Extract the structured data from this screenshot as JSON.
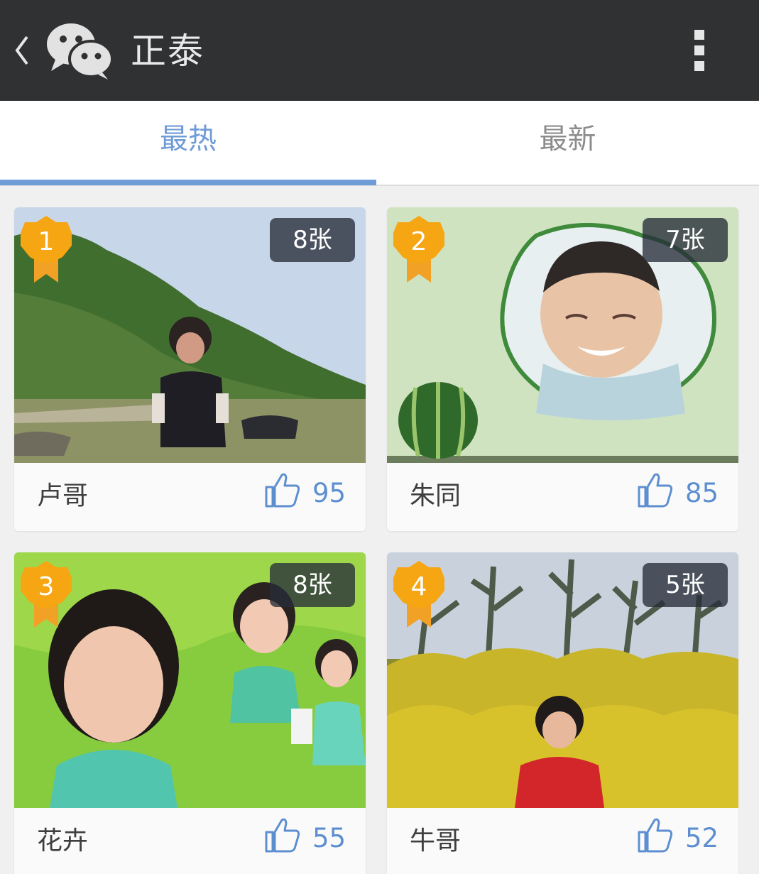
{
  "header": {
    "title": "正泰",
    "back_icon": "chevron-left-icon",
    "logo_icon": "wechat-icon",
    "menu_icon": "more-vertical-icon"
  },
  "tabs": [
    {
      "label": "最热",
      "active": true
    },
    {
      "label": "最新",
      "active": false
    }
  ],
  "colors": {
    "header_bg": "#2f3133",
    "accent": "#6f9bd6",
    "rank_badge": "#f5a012",
    "like_count": "#5d8fd0"
  },
  "cards": [
    {
      "rank": "1",
      "count": "8张",
      "name": "卢哥",
      "likes": "95"
    },
    {
      "rank": "2",
      "count": "7张",
      "name": "朱同",
      "likes": "85"
    },
    {
      "rank": "3",
      "count": "8张",
      "name": "花卉",
      "likes": "55"
    },
    {
      "rank": "4",
      "count": "5张",
      "name": "牛哥",
      "likes": "52"
    }
  ]
}
